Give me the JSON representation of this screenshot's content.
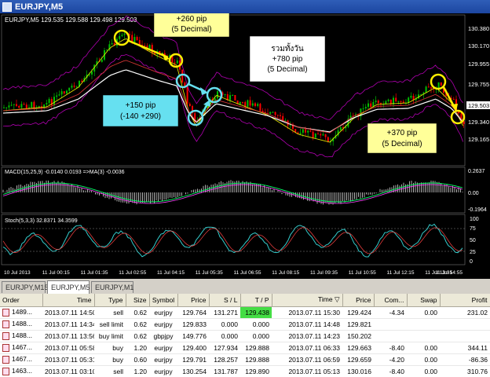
{
  "window": {
    "title": "EURJPY,M5"
  },
  "chart": {
    "header": "EURJPY,M5  129.535 129.588 129.498 129.503",
    "price_labels": [
      "130.380",
      "130.170",
      "129.955",
      "129.755",
      "129.550",
      "129.340",
      "129.165"
    ],
    "current_price": "129.503",
    "macd_label": "MACD(15,25,9) -0.0140 0.0193  =>MA(3) -0.0036",
    "macd_scale": [
      "0.2637",
      "0.00",
      "-0.1964"
    ],
    "stoch_label": "Stoch(5,3,3) 32.8371 34.3599",
    "stoch_scale": [
      "100",
      "75",
      "50",
      "25",
      "0"
    ],
    "time_labels": [
      "10 Jul 2013",
      "11 Jul 00:15",
      "11 Jul 01:35",
      "11 Jul 02:55",
      "11 Jul 04:15",
      "11 Jul 05:35",
      "11 Jul 06:55",
      "11 Jul 08:15",
      "11 Jul 09:35",
      "11 Jul 10:55",
      "11 Jul 12:15",
      "11 Jul 13:35",
      "11 Jul 14:55"
    ],
    "annotations": {
      "box1_line1": "+260 pip",
      "box1_line2": "(5 Decimal)",
      "box2_line1": "+150 pip",
      "box2_line2": "(-140 +290)",
      "box3_line1": "รวมทั้งวัน",
      "box3_line2": "+780 pip",
      "box3_line3": "(5 Decimal)",
      "box4_line1": "+370 pip",
      "box4_line2": "(5 Decimal)"
    }
  },
  "tabs": [
    {
      "label": "EURJPY,M15",
      "active": false
    },
    {
      "label": "EURJPY,M5",
      "active": true
    },
    {
      "label": "EURJPY,M1",
      "active": false
    }
  ],
  "table": {
    "headers": [
      "Order",
      "Time",
      "Type",
      "Size",
      "Symbol",
      "Price",
      "S / L",
      "T / P",
      "Time",
      "Price",
      "Com...",
      "Swap",
      "Profit"
    ],
    "sort_indicator": "▽",
    "rows": [
      [
        "1489...",
        "2013.07.11 14:50",
        "sell",
        "0.62",
        "eurjpy",
        "129.764",
        "131.271",
        "129.438",
        "2013.07.11 15:30",
        "129.424",
        "-4.34",
        "0.00",
        "231.02"
      ],
      [
        "1488...",
        "2013.07.11 14:34",
        "sell limit",
        "0.62",
        "eurjpy",
        "129.833",
        "0.000",
        "0.000",
        "2013.07.11 14:48",
        "129.821",
        "",
        "",
        ""
      ],
      [
        "1488...",
        "2013.07.11 13:56",
        "buy limit",
        "0.62",
        "gbpjpy",
        "149.776",
        "0.000",
        "0.000",
        "2013.07.11 14:23",
        "150.202",
        "",
        "",
        ""
      ],
      [
        "1467...",
        "2013.07.11 05:58",
        "buy",
        "1.20",
        "eurjpy",
        "129.400",
        "127.934",
        "129.888",
        "2013.07.11 06:33",
        "129.663",
        "-8.40",
        "0.00",
        "344.11"
      ],
      [
        "1467...",
        "2013.07.11 05:31",
        "buy",
        "0.60",
        "eurjpy",
        "129.791",
        "128.257",
        "129.888",
        "2013.07.11 06:59",
        "129.659",
        "-4.20",
        "0.00",
        "-86.36"
      ],
      [
        "1463...",
        "2013.07.11 03:10",
        "sell",
        "1.20",
        "eurjpy",
        "130.254",
        "131.787",
        "129.890",
        "2013.07.11 05:13",
        "130.016",
        "-8.40",
        "0.00",
        "310.76"
      ]
    ]
  },
  "colors": {
    "candle_up": "#00c000",
    "candle_down": "#ff0000",
    "annotation_yellow": "#ffff99",
    "annotation_cyan": "#66e0f0",
    "highlight_tp": "#44dd44"
  }
}
